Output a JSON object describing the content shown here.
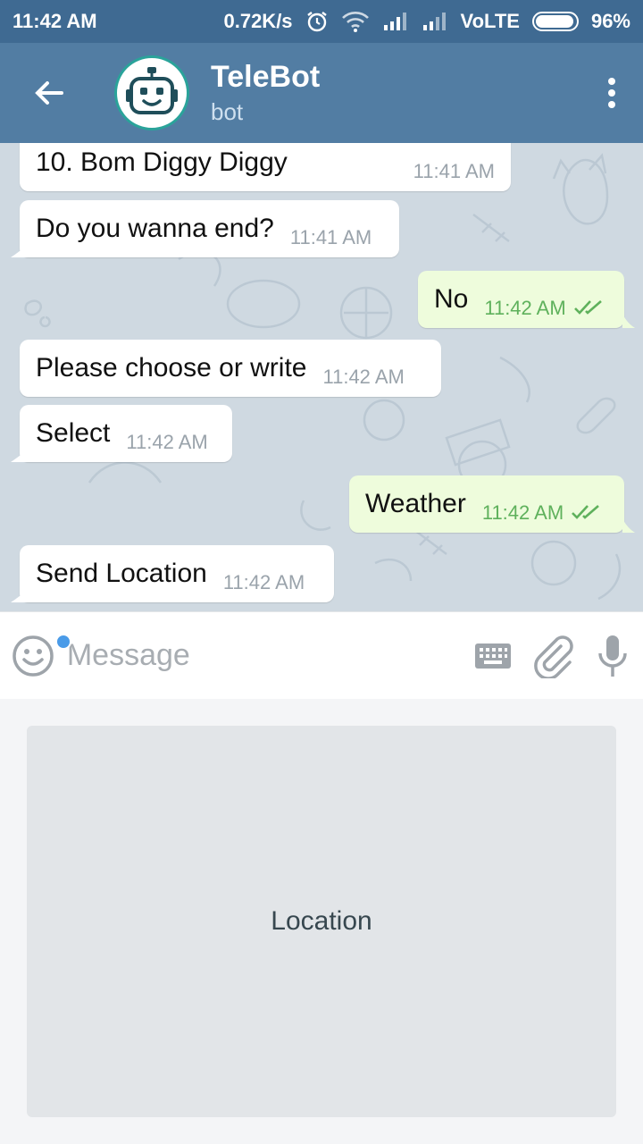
{
  "status_bar": {
    "time": "11:42 AM",
    "network_speed": "0.72K/s",
    "network_type": "VoLTE",
    "battery": "96%",
    "icons": [
      "alarm-icon",
      "wifi-icon",
      "signal-icon",
      "signal-icon",
      "battery-icon"
    ]
  },
  "header": {
    "title": "TeleBot",
    "subtitle": "bot",
    "icons": [
      "back-arrow-icon",
      "robot-avatar-icon",
      "more-vert-icon"
    ]
  },
  "messages": [
    {
      "direction": "in",
      "text": "10. Bom Diggy Diggy",
      "time": "11:41 AM"
    },
    {
      "direction": "in",
      "text": "Do you wanna end?",
      "time": "11:41 AM"
    },
    {
      "direction": "out",
      "text": "No",
      "time": "11:42 AM",
      "status": "read"
    },
    {
      "direction": "in",
      "text": "Please choose or write",
      "time": "11:42 AM"
    },
    {
      "direction": "in",
      "text": "Select",
      "time": "11:42 AM"
    },
    {
      "direction": "out",
      "text": "Weather",
      "time": "11:42 AM",
      "status": "read"
    },
    {
      "direction": "in",
      "text": "Send Location",
      "time": "11:42 AM"
    }
  ],
  "input_bar": {
    "placeholder": "Message",
    "icons": [
      "emoji-icon",
      "keyboard-icon",
      "attach-icon",
      "mic-icon"
    ]
  },
  "bot_keyboard": {
    "buttons": [
      "Location"
    ]
  },
  "colors": {
    "status_bar": "#3f6a92",
    "header": "#527da3",
    "outgoing_bubble": "#eefcdc",
    "incoming_bubble": "#ffffff",
    "read_check": "#5fb15c",
    "notification_dot": "#4a9be8"
  }
}
